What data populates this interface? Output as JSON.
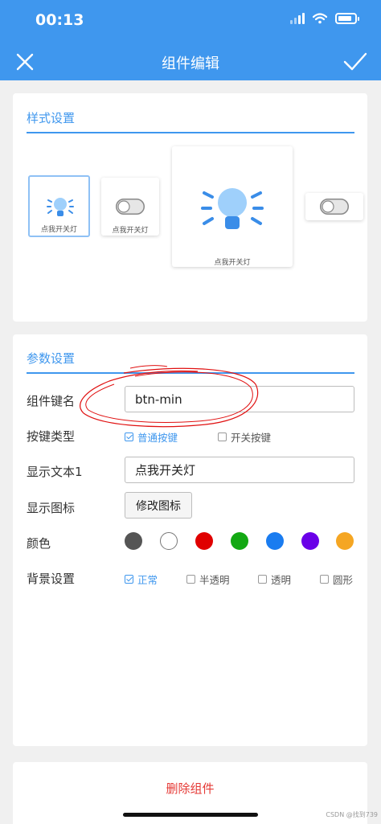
{
  "status_bar": {
    "time": "00:13"
  },
  "header": {
    "title": "组件编辑"
  },
  "style_section": {
    "title": "样式设置",
    "tiles": [
      {
        "label": "点我开关灯",
        "kind": "bulb",
        "selected": true
      },
      {
        "label": "点我开关灯",
        "kind": "switch"
      },
      {
        "label": "点我开关灯",
        "kind": "bulb-large"
      },
      {
        "label": "",
        "kind": "switch-plain"
      }
    ]
  },
  "param_section": {
    "title": "参数设置",
    "key_name": {
      "label": "组件键名",
      "value": "btn-min"
    },
    "key_type": {
      "label": "按键类型",
      "options": [
        "普通按键",
        "开关按键"
      ],
      "selected": 0
    },
    "display_text": {
      "label": "显示文本1",
      "value": "点我开关灯"
    },
    "display_icon": {
      "label": "显示图标",
      "button": "修改图标"
    },
    "color": {
      "label": "颜色",
      "swatches": [
        "#555555",
        "#ffffff",
        "#e00000",
        "#13a813",
        "#1a7cf0",
        "#6a00e8",
        "#f5a623"
      ]
    },
    "background": {
      "label": "背景设置",
      "options": [
        "正常",
        "半透明",
        "透明",
        "圆形"
      ],
      "selected": 0
    }
  },
  "delete_button": "删除组件",
  "watermark": "CSDN @找到739",
  "colors": {
    "accent": "#3f97ee",
    "danger": "#e53935",
    "bulb_light": "#9fd0fb",
    "bulb_base": "#3a8de8"
  }
}
